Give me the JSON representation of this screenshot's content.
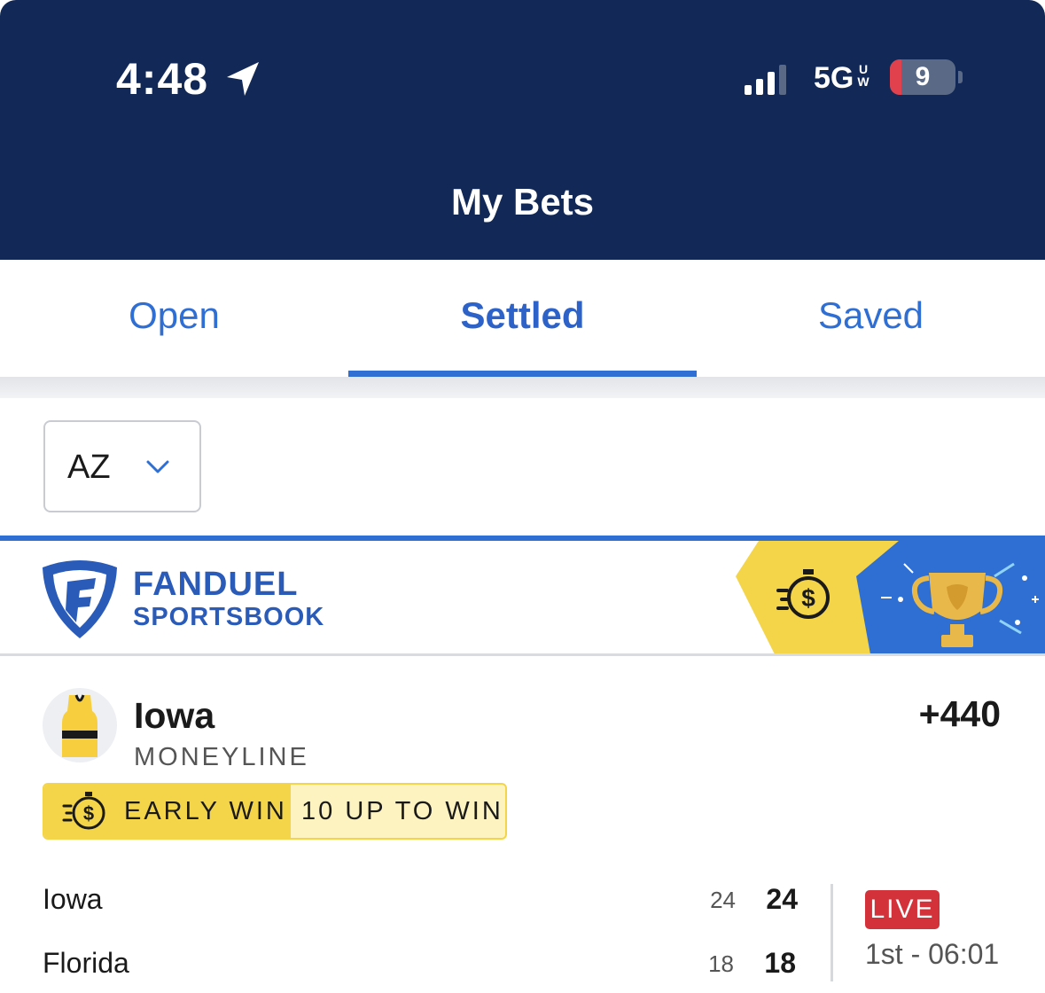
{
  "status_bar": {
    "time": "4:48",
    "network": "5G",
    "network_badge_top": "U",
    "network_badge_bottom": "W",
    "battery_level": "9",
    "battery_fraction": 0.09,
    "icons": [
      "location-arrow-icon",
      "cellular-signal-icon",
      "battery-icon"
    ]
  },
  "header": {
    "title": "My Bets"
  },
  "tabs": [
    {
      "label": "Open",
      "active": false
    },
    {
      "label": "Settled",
      "active": true
    },
    {
      "label": "Saved",
      "active": false
    }
  ],
  "state_filter": {
    "value": "AZ",
    "icon": "chevron-down-icon"
  },
  "banner": {
    "brand_name": "FANDUEL",
    "brand_sub": "SPORTSBOOK",
    "icons": [
      "fanduel-shield-icon",
      "stopwatch-dollar-icon",
      "trophy-icon"
    ],
    "colors": {
      "yellow": "#f4d54a",
      "blue": "#2f6fd4"
    }
  },
  "bet": {
    "team": "Iowa",
    "market": "MONEYLINE",
    "odds": "+440",
    "avatar_icon": "jersey-icon",
    "badge": {
      "label": "EARLY WIN",
      "detail": "10 UP TO WIN",
      "icon": "stopwatch-dollar-icon"
    }
  },
  "scoreboard": {
    "rows": [
      {
        "team": "Iowa",
        "period_score": "24",
        "total": "24"
      },
      {
        "team": "Florida",
        "period_score": "18",
        "total": "18"
      }
    ],
    "status": "LIVE",
    "clock": "1st - 06:01"
  },
  "colors": {
    "header_bg": "#122856",
    "accent": "#2f6fd4",
    "live": "#d4323a"
  }
}
